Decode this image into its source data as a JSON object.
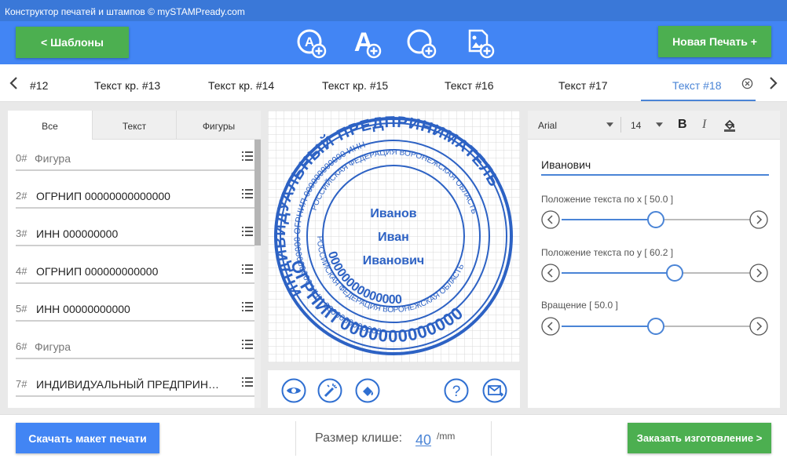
{
  "window": {
    "title": "Конструктор печатей и штампов © mySTAMPready.com"
  },
  "toolbar": {
    "templates_label": "<  Шаблоны",
    "new_stamp_label": "Новая Печать +",
    "icons": [
      "add-circle-text-icon",
      "add-text-icon",
      "add-circle-icon",
      "add-image-icon"
    ]
  },
  "tabs": [
    {
      "label": "#12"
    },
    {
      "label": "Текст кр. #13"
    },
    {
      "label": "Текст кр. #14"
    },
    {
      "label": "Текст кр. #15"
    },
    {
      "label": "Текст #16"
    },
    {
      "label": "Текст #17"
    },
    {
      "label": "Текст #18",
      "active": true
    }
  ],
  "left_panel": {
    "tabs": [
      "Все",
      "Текст",
      "Фигуры"
    ],
    "items": [
      {
        "num": "0#",
        "text": "Фигура"
      },
      {
        "num": "2#",
        "text": "ОГРНИП 00000000000000"
      },
      {
        "num": "3#",
        "text": "ИНН 000000000"
      },
      {
        "num": "4#",
        "text": "ОГРНИП 000000000000"
      },
      {
        "num": "5#",
        "text": "ИНН 00000000000"
      },
      {
        "num": "6#",
        "text": "Фигура"
      },
      {
        "num": "7#",
        "text": "ИНДИВИДУАЛЬНЫЙ ПРЕДПРИН…"
      }
    ]
  },
  "stamp": {
    "center_lines": [
      "Иванов",
      "Иван",
      "Иванович"
    ],
    "outer_top": "ИНДИВИДУАЛЬНЫЙ ПРЕДПРИНИМАТЕЛЬ",
    "outer_bottom": "ОГРНИП 0000000000000",
    "ring2": "0000000000000 ИНН 0000000000 ОГРНИП 000000000000 ИНН",
    "ring3": "РОССИЙСКАЯ ФЕДЕРАЦИЯ ВОРОНЕЖСКАЯ ОБЛАСТЬ",
    "ring4": "РОССИЙСКАЯ ФЕДЕРАЦИЯ ВОРОНЕЖСКАЯ ОБЛАСТЬ",
    "inner_bottom": "00000000000000",
    "color": "#2d62c4"
  },
  "right_panel": {
    "font": "Arial",
    "size": "14",
    "text_value": "Иванович",
    "sliders": [
      {
        "label": "Положение текста по x [ 50.0 ]",
        "value": 0.5
      },
      {
        "label": "Положение текста по y [ 60.2 ]",
        "value": 0.602
      },
      {
        "label": "Вращение [ 50.0 ]",
        "value": 0.5
      }
    ]
  },
  "footer": {
    "download_label": "Скачать макет печати",
    "size_label": "Размер клише:",
    "size_value": "40",
    "size_unit": "/mm",
    "order_label": "Заказать изготовление >"
  },
  "colors": {
    "accent": "#4285f4",
    "green": "#4caf50",
    "tab_active": "#4a84d6"
  }
}
